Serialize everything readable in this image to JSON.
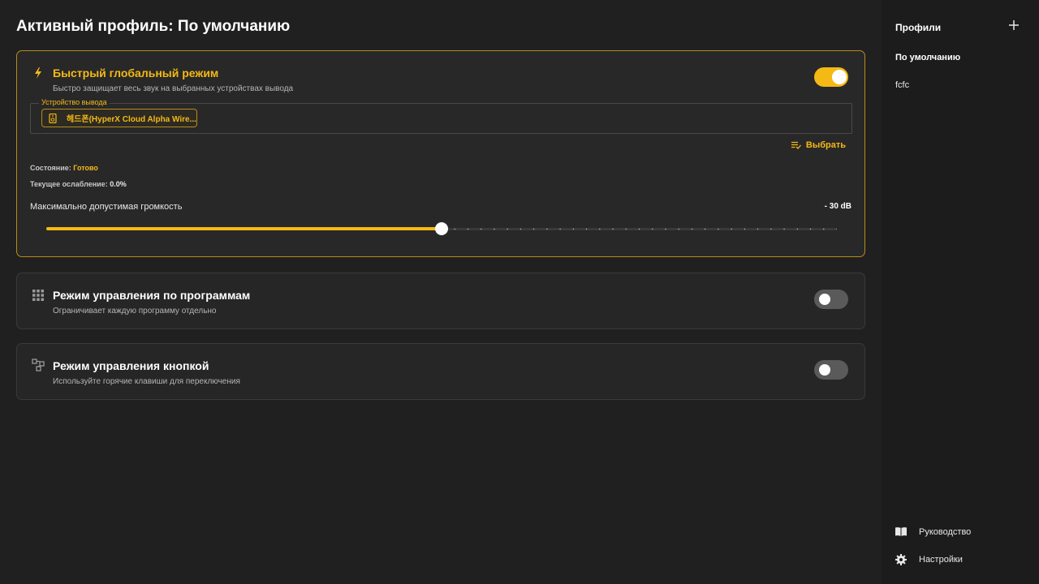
{
  "page_title": "Активный профиль: По умолчанию",
  "quick_mode": {
    "title": "Быстрый глобальный режим",
    "subtitle": "Быстро защищает весь звук на выбранных устройствах вывода",
    "enabled": true,
    "icon": "lightning-icon",
    "output_device_legend": "Устройство вывода",
    "device_chip": "헤드폰(HyperX Cloud Alpha Wire...",
    "select_label": "Выбрать",
    "status_label": "Состояние:",
    "status_value": "Готово",
    "attenuation_label": "Текущее ослабление:",
    "attenuation_value": "0.0%",
    "volume_label": "Максимально допустимая громкость",
    "volume_value": "- 30 dB",
    "slider_fraction": 0.5
  },
  "program_mode": {
    "title": "Режим управления по программам",
    "subtitle": "Ограничивает каждую программу отдельно",
    "enabled": false,
    "icon": "grid-icon"
  },
  "button_mode": {
    "title": "Режим управления кнопкой",
    "subtitle": "Используйте горячие клавиши для переключения",
    "enabled": false,
    "icon": "hotkey-icon"
  },
  "sidebar": {
    "header": "Профили",
    "profiles": [
      "По умолчанию",
      "fcfc"
    ],
    "guide_label": "Руководство",
    "settings_label": "Настройки"
  },
  "colors": {
    "accent": "#f5b915",
    "background": "#202020",
    "sidebar": "#1c1c1c"
  }
}
